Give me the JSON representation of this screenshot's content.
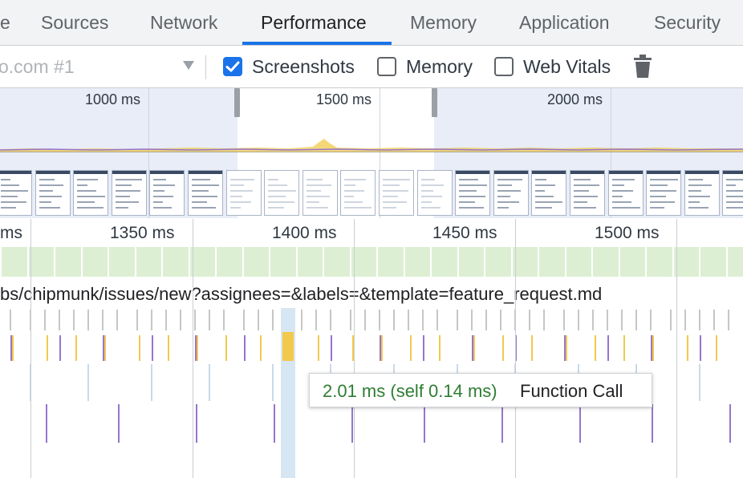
{
  "tabs": [
    {
      "label": "e"
    },
    {
      "label": "Sources"
    },
    {
      "label": "Network"
    },
    {
      "label": "Performance",
      "active": true
    },
    {
      "label": "Memory"
    },
    {
      "label": "Application"
    },
    {
      "label": "Security"
    }
  ],
  "toolbar": {
    "profile_select": "o.com #1",
    "screenshots": {
      "label": "Screenshots",
      "checked": true
    },
    "memory": {
      "label": "Memory",
      "checked": false
    },
    "web_vitals": {
      "label": "Web Vitals",
      "checked": false
    },
    "trash_icon": "trash-icon"
  },
  "overview": {
    "labels": [
      "1000 ms",
      "1500 ms",
      "2000 ms"
    ]
  },
  "ruler": {
    "labels": [
      "ms",
      "1350 ms",
      "1400 ms",
      "1450 ms",
      "1500 ms"
    ]
  },
  "main": {
    "url_text": "bs/chipmunk/issues/new?assignees=&labels=&template=feature_request.md"
  },
  "tooltip": {
    "time": "2.01 ms (self 0.14 ms)",
    "name": "Function Call"
  },
  "colors": {
    "accent": "#1a73e8",
    "tooltip_time": "#2e7d32",
    "frames_track": "#dcefd3",
    "scripting": "#f2c94c",
    "rendering": "#9575cd"
  }
}
